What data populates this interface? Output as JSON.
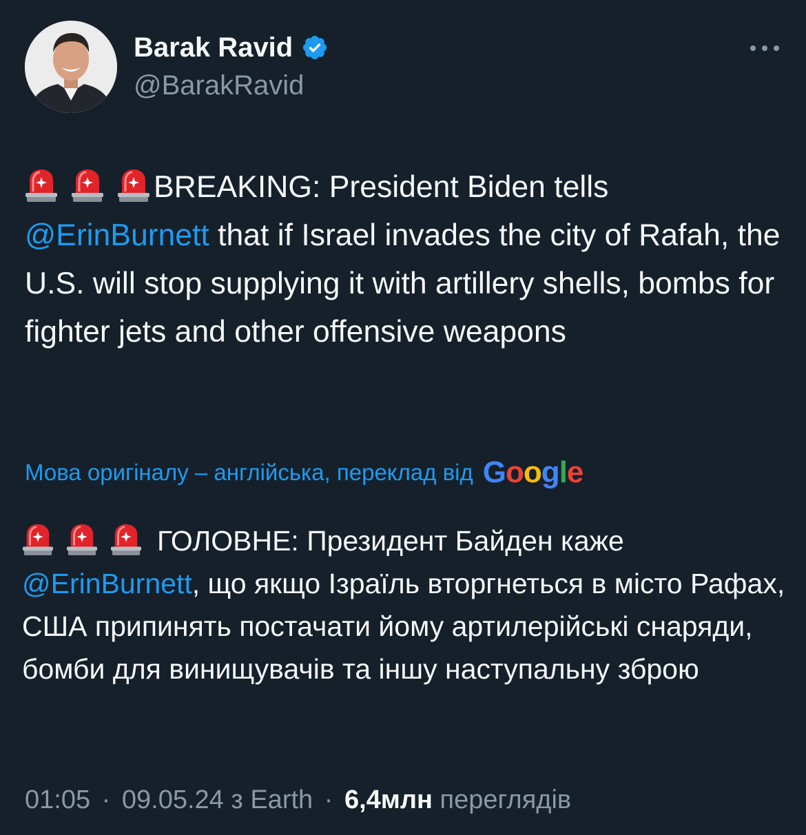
{
  "author": {
    "name": "Barak Ravid",
    "handle": "@BarakRavid",
    "verified": true
  },
  "tweet": {
    "breaking_label": "BREAKING: President Biden tells",
    "mention": "@ErinBurnett",
    "body_after_mention": "that if Israel invades the city of Rafah, the U.S. will stop supplying it with artillery shells, bombs for fighter jets and other offensive weapons",
    "emoji": "rotating-light-icon"
  },
  "translation": {
    "note": "Мова оригіналу – англійська, переклад від",
    "provider": "Google",
    "headline": "ГОЛОВНЕ: Президент Байден каже",
    "mention": "@ErinBurnett",
    "body_after_mention": ", що якщо Ізраїль вторгнеться в місто Рафах, США припинять постачати йому артилерійські снаряди, бомби для винищувачів та іншу наступальну зброю"
  },
  "meta": {
    "time": "01:05",
    "date": "09.05.24",
    "source": "з Earth",
    "views_count": "6,4млн",
    "views_label": "переглядів",
    "separator": "·"
  },
  "colors": {
    "background": "#15202b",
    "text": "#f7f9f9",
    "secondary": "#8b98a5",
    "accent": "#1d9bf0",
    "verified": "#1d9bf0"
  }
}
